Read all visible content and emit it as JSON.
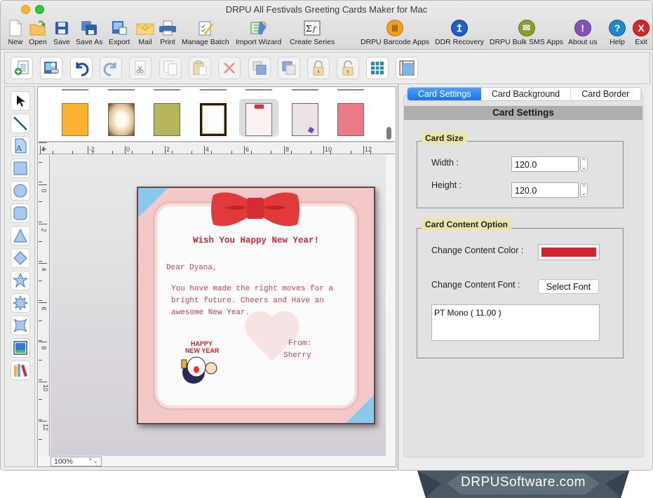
{
  "window": {
    "title": "DRPU All Festivals Greeting Cards Maker for Mac"
  },
  "main_toolbar": {
    "left_items": [
      {
        "label": "New",
        "icon": "new-document-icon"
      },
      {
        "label": "Open",
        "icon": "open-folder-icon"
      },
      {
        "label": "Save",
        "icon": "save-disk-icon"
      },
      {
        "label": "Save As",
        "icon": "save-as-icon"
      },
      {
        "label": "Export",
        "icon": "export-icon"
      },
      {
        "label": "Mail",
        "icon": "mail-envelope-icon"
      },
      {
        "label": "Print",
        "icon": "printer-icon"
      },
      {
        "label": "Manage Batch",
        "icon": "manage-batch-icon"
      },
      {
        "label": "Import Wizard",
        "icon": "import-wizard-icon"
      },
      {
        "label": "Create Series",
        "icon": "sigma-function-icon"
      }
    ],
    "right_items": [
      {
        "label": "DRPU Barcode Apps",
        "icon": "barcode-icon",
        "color": "#f0a020"
      },
      {
        "label": "DDR Recovery",
        "icon": "recovery-icon",
        "color": "#1d5fc4"
      },
      {
        "label": "DRPU Bulk SMS Apps",
        "icon": "sms-envelope-icon",
        "color": "#8e9a2a"
      },
      {
        "label": "About us",
        "icon": "about-icon",
        "color": "#8552b8"
      },
      {
        "label": "Help",
        "icon": "help-icon",
        "color": "#1f88c8"
      },
      {
        "label": "Exit",
        "icon": "exit-icon",
        "color": "#d02828"
      }
    ],
    "right_glyphs": [
      "|||",
      "↥",
      "✉",
      "!",
      "?",
      "X"
    ]
  },
  "edit_toolbar": [
    {
      "name": "add-text-icon",
      "enabled": true
    },
    {
      "name": "insert-image-icon",
      "enabled": true
    },
    {
      "name": "undo-icon",
      "enabled": true
    },
    {
      "name": "redo-icon",
      "enabled": false
    },
    {
      "name": "cut-icon",
      "enabled": false
    },
    {
      "name": "copy-icon",
      "enabled": false
    },
    {
      "name": "paste-icon",
      "enabled": false
    },
    {
      "name": "delete-icon",
      "enabled": false
    },
    {
      "name": "bring-front-icon",
      "enabled": false
    },
    {
      "name": "send-back-icon",
      "enabled": false
    },
    {
      "name": "lock-icon",
      "enabled": false
    },
    {
      "name": "unlock-icon",
      "enabled": false
    },
    {
      "name": "grid-icon",
      "enabled": true
    },
    {
      "name": "ruler-icon",
      "enabled": true
    }
  ],
  "drawing_tools": [
    "pointer-icon",
    "line-icon",
    "text-icon",
    "rectangle-icon",
    "ellipse-icon",
    "rounded-rectangle-icon",
    "triangle-icon",
    "diamond-icon",
    "star-icon",
    "burst-icon",
    "concave-star-icon",
    "picture-icon",
    "library-icon"
  ],
  "thumbnails": [
    {
      "name": "orange-card",
      "color": "#fbb32f"
    },
    {
      "name": "vintage-brown-card",
      "color": "#e9d9b7"
    },
    {
      "name": "olive-card",
      "color": "#b6b559"
    },
    {
      "name": "black-border-card",
      "color": "#ffffff"
    },
    {
      "name": "pink-bow-card",
      "color": "#f9e4e4",
      "selected": true
    },
    {
      "name": "lilac-card",
      "color": "#ece4e4"
    },
    {
      "name": "rose-card",
      "color": "#e97b88"
    }
  ],
  "rulers": {
    "horizontal": [
      "4",
      "-2",
      "0",
      "2",
      "4",
      "6",
      "8",
      "10",
      "12"
    ],
    "vertical": [
      "4",
      "0",
      "2",
      "4",
      "6",
      "8",
      "10",
      "12"
    ]
  },
  "zoom": {
    "value": "100%",
    "arrows": "⌃⌄"
  },
  "card": {
    "title": "Wish You Happy New Year!",
    "greeting": "Dear Dyana,",
    "body": "You have made the right moves for a\nbright future. Cheers and Have an\nawesome New Year.",
    "from_label": "From:",
    "from_name": "Sherry",
    "sticker_text": "HAPPY\nNEW YEAR"
  },
  "right_panel": {
    "tabs": [
      {
        "label": "Card Settings",
        "active": true
      },
      {
        "label": "Card Background",
        "active": false
      },
      {
        "label": "Card Border",
        "active": false
      }
    ],
    "header": "Card Settings",
    "card_size": {
      "legend": "Card Size",
      "width_label": "Width :",
      "width_value": "120.0",
      "height_label": "Height :",
      "height_value": "120.0"
    },
    "content_option": {
      "legend": "Card Content Option",
      "color_label": "Change Content Color :",
      "color_value": "#d2232f",
      "font_label": "Change Content Font :",
      "font_button": "Select Font",
      "font_value": "PT Mono ( 11.00 )"
    }
  },
  "watermark": {
    "text": "DRPUSoftware.com"
  }
}
